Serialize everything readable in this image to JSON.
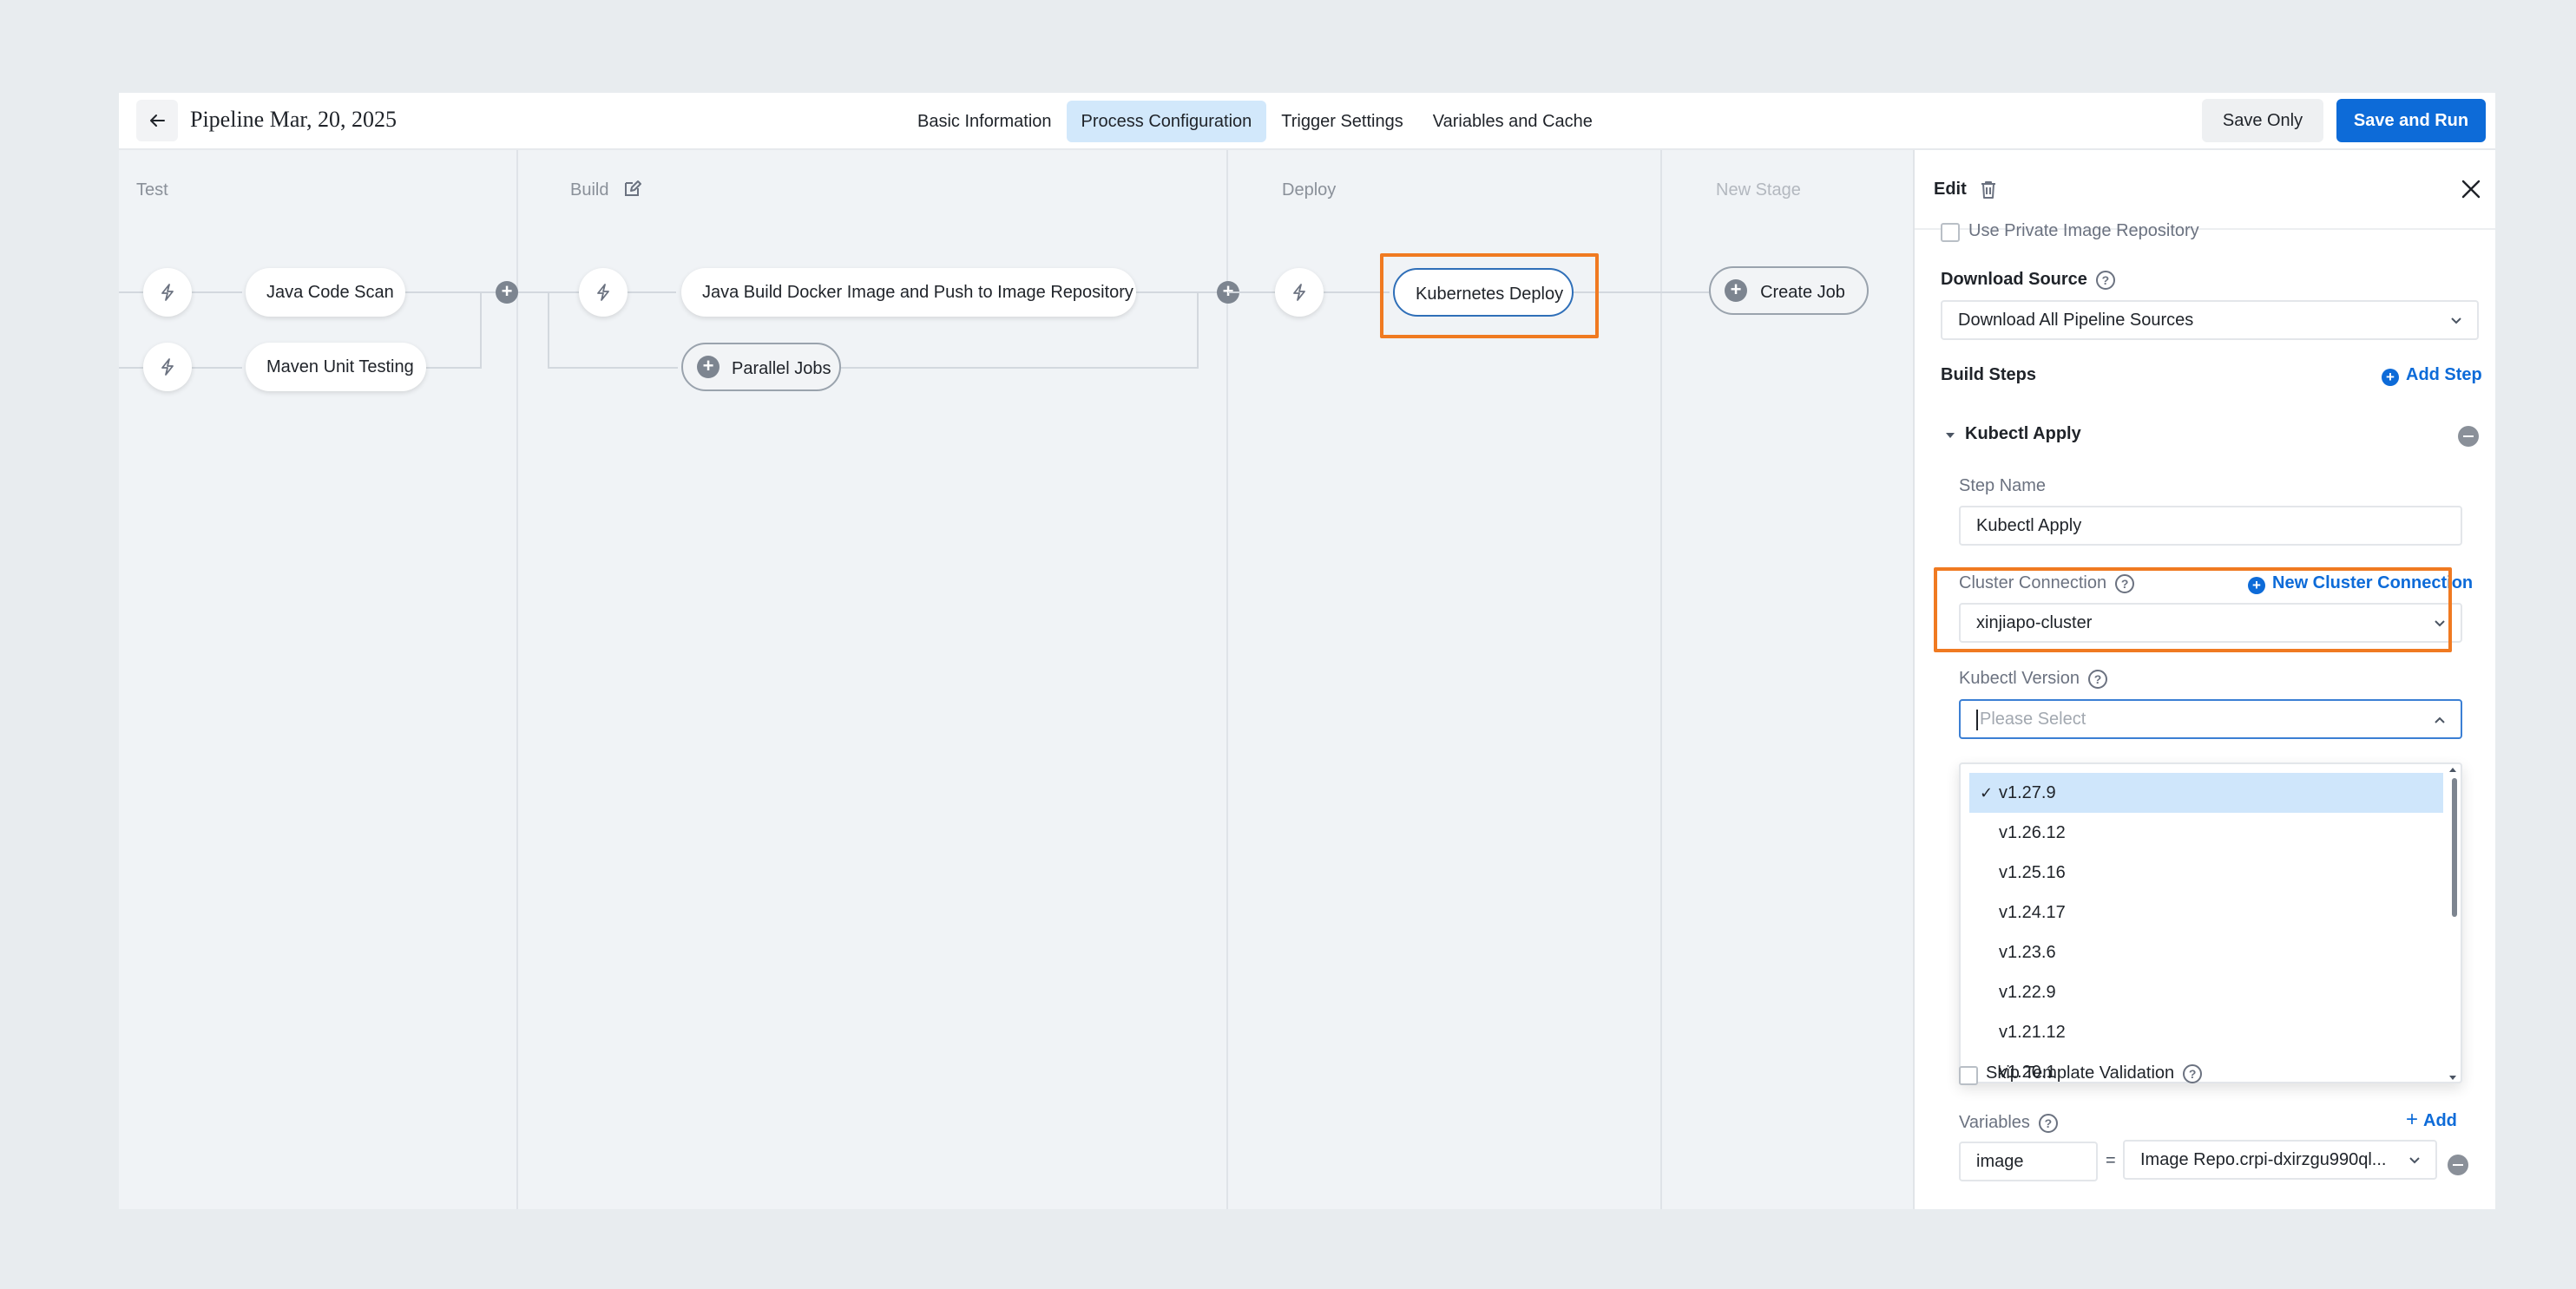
{
  "header": {
    "title": "Pipeline Mar, 20, 2025",
    "tabs": [
      {
        "label": "Basic Information",
        "active": false
      },
      {
        "label": "Process Configuration",
        "active": true
      },
      {
        "label": "Trigger Settings",
        "active": false
      },
      {
        "label": "Variables and Cache",
        "active": false
      }
    ],
    "save_only": "Save Only",
    "save_and_run": "Save and Run"
  },
  "stages": {
    "test": {
      "title": "Test",
      "jobs": [
        "Java Code Scan",
        "Maven Unit Testing"
      ]
    },
    "build": {
      "title": "Build",
      "jobs": [
        "Java Build Docker Image and Push to Image Repository"
      ],
      "parallel": "Parallel Jobs"
    },
    "deploy": {
      "title": "Deploy",
      "jobs": [
        "Kubernetes Deploy"
      ]
    },
    "new": {
      "title": "New Stage",
      "create_job": "Create Job"
    }
  },
  "panel": {
    "title": "Edit",
    "use_private_repo": "Use Private Image Repository",
    "download_source_label": "Download Source",
    "download_source_value": "Download All Pipeline Sources",
    "build_steps_label": "Build Steps",
    "add_step": "Add Step",
    "step_group": "Kubectl Apply",
    "step_name_label": "Step Name",
    "step_name_value": "Kubectl Apply",
    "cluster_label": "Cluster Connection",
    "new_cluster": "New Cluster Connection",
    "cluster_value": "xinjiapo-cluster",
    "kubectl_version_label": "Kubectl Version",
    "kubectl_version_placeholder": "Please Select",
    "versions": [
      "v1.27.9",
      "v1.26.12",
      "v1.25.16",
      "v1.24.17",
      "v1.23.6",
      "v1.22.9",
      "v1.21.12",
      "v1.20.1"
    ],
    "selected_version": "v1.27.9",
    "skip_template": "Skip Template Validation",
    "variables_label": "Variables",
    "add_var": "Add",
    "var_key": "image",
    "var_eq": "=",
    "var_value": "Image Repo.crpi-dxirzgu990ql..."
  },
  "colors": {
    "accent": "#0d6bd8",
    "highlight": "#f07a21",
    "tab_active": "#d2e8fb"
  }
}
